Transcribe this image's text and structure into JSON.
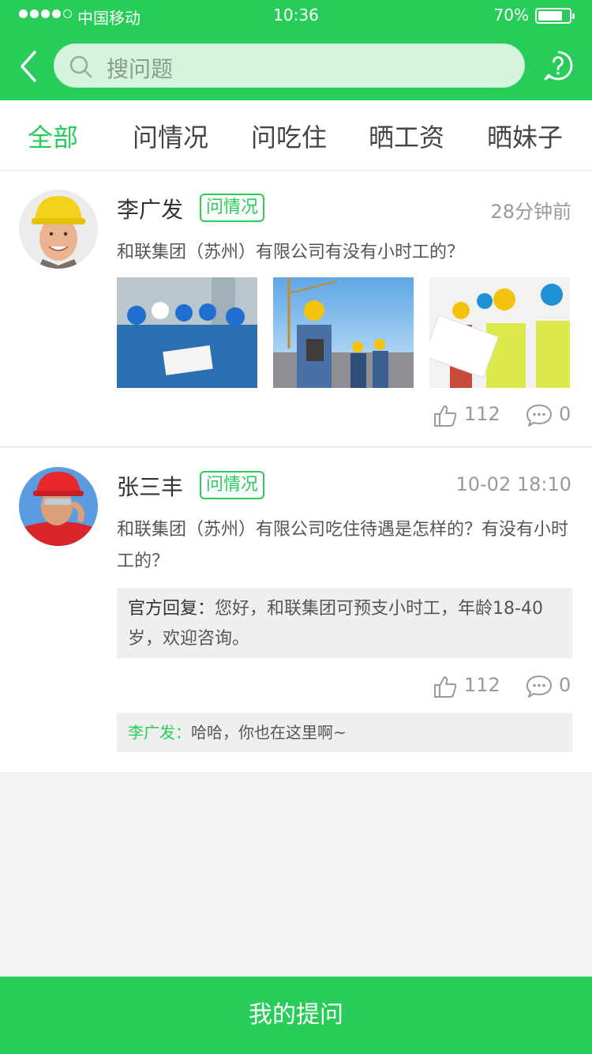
{
  "status_bar": {
    "carrier": "中国移动",
    "time": "10:36",
    "battery": "70%",
    "battery_level": 0.7
  },
  "header": {
    "search_placeholder": "搜问题",
    "icons": {
      "back": "chevron-left-icon",
      "search": "search-icon",
      "help": "help-icon"
    },
    "accent_color": "#27cd58"
  },
  "tabs": [
    {
      "label": "全部",
      "active": true
    },
    {
      "label": "问情况",
      "active": false
    },
    {
      "label": "问吃住",
      "active": false
    },
    {
      "label": "晒工资",
      "active": false
    },
    {
      "label": "晒妹子",
      "active": false
    }
  ],
  "posts": [
    {
      "username": "李广发",
      "tag": "问情况",
      "time": "28分钟前",
      "question": "和联集团（苏州）有限公司有没有小时工的？",
      "likes": "112",
      "comments": "0"
    },
    {
      "username": "张三丰",
      "tag": "问情况",
      "time": "10-02 18:10",
      "question": "和联集团（苏州）有限公司吃住待遇是怎样的？有没有小时工的？",
      "official_label": "官方回复：",
      "official_text": "您好，和联集团可预支小时工，年龄18-40岁，欢迎咨询。",
      "likes": "112",
      "comments": "0",
      "reply_author": "李广发：",
      "reply_text": "哈哈，你也在这里啊~"
    }
  ],
  "bottom_button": "我的提问"
}
